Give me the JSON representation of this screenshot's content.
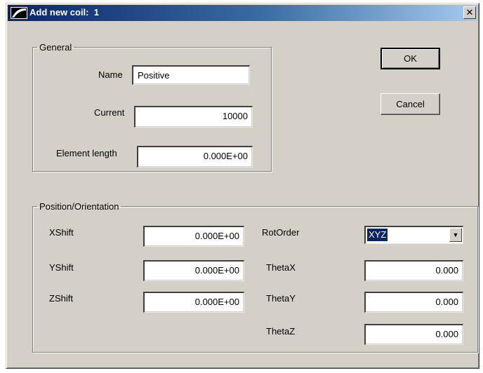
{
  "window": {
    "title": "Add new coil:  1",
    "close_glyph": "✕",
    "icon": "app-logo-icon"
  },
  "buttons": {
    "ok_label": "OK",
    "cancel_label": "Cancel"
  },
  "general": {
    "legend": "General",
    "name": {
      "label": "Name",
      "value": "Positive"
    },
    "current": {
      "label": "Current",
      "value": "10000"
    },
    "element_length": {
      "label": "Element length",
      "value": "0.000E+00"
    }
  },
  "position": {
    "legend": "Position/Orientation",
    "xshift": {
      "label": "XShift",
      "value": "0.000E+00"
    },
    "yshift": {
      "label": "YShift",
      "value": "0.000E+00"
    },
    "zshift": {
      "label": "ZShift",
      "value": "0.000E+00"
    },
    "rotorder": {
      "label": "RotOrder",
      "value": "XYZ",
      "arrow": "▼"
    },
    "thetax": {
      "label": "ThetaX",
      "value": "0.000"
    },
    "thetay": {
      "label": "ThetaY",
      "value": "0.000"
    },
    "thetaz": {
      "label": "ThetaZ",
      "value": "0.000"
    }
  },
  "colors": {
    "window_bg": "#d4d0c8",
    "title_start": "#0a246a",
    "title_end": "#a6caf0",
    "selection": "#0a246a"
  }
}
